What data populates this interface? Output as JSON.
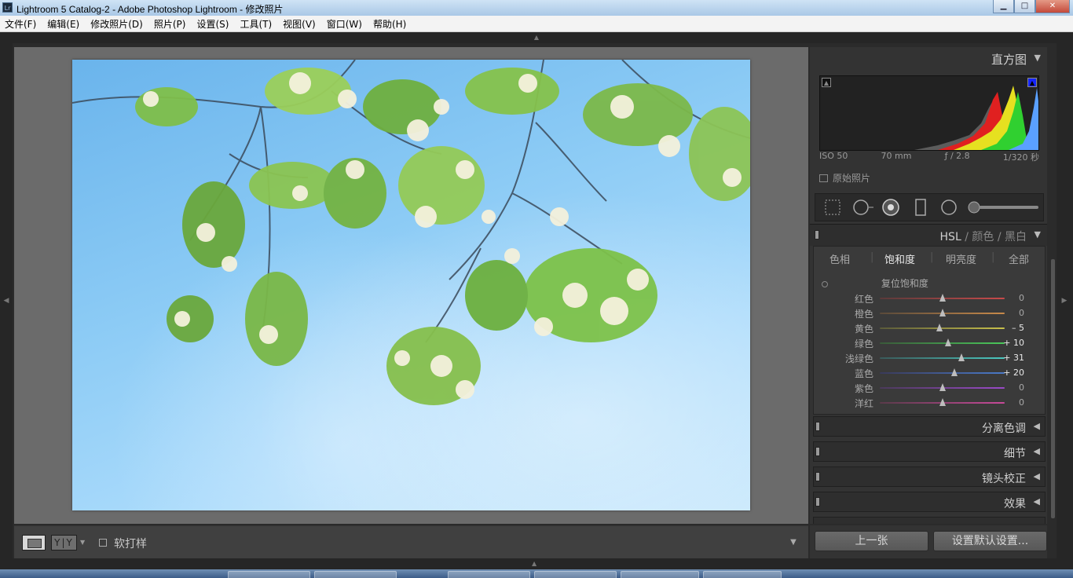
{
  "window": {
    "title": "Lightroom 5 Catalog-2 - Adobe Photoshop Lightroom - 修改照片",
    "app_icon": "Lr",
    "minimize": "▁",
    "maximize": "□",
    "close": "✕"
  },
  "menu": [
    "文件(F)",
    "编辑(E)",
    "修改照片(D)",
    "照片(P)",
    "设置(S)",
    "工具(T)",
    "视图(V)",
    "窗口(W)",
    "帮助(H)"
  ],
  "toolbar": {
    "soft_proof_label": "软打样",
    "soft_proof_checked": false,
    "yy_label": "Y|Y"
  },
  "histogram": {
    "title": "直方图",
    "iso": "ISO 50",
    "focal": "70 mm",
    "aperture": "ƒ / 2.8",
    "shutter": "1/320 秒",
    "original_label": "原始照片"
  },
  "hsl": {
    "tabs": [
      "HSL",
      "颜色",
      "黑白"
    ],
    "active_tab": "HSL",
    "subtabs": [
      "色相",
      "饱和度",
      "明亮度",
      "全部"
    ],
    "active_subtab": "饱和度",
    "reset_label": "复位饱和度",
    "sliders": [
      {
        "label": "红色",
        "value": 0,
        "display": "0",
        "color_from": "#5a3a3a",
        "color_to": "#c84a4a"
      },
      {
        "label": "橙色",
        "value": 0,
        "display": "0",
        "color_from": "#5a4a3a",
        "color_to": "#c88a4a"
      },
      {
        "label": "黄色",
        "value": -5,
        "display": "– 5",
        "color_from": "#5a5a3a",
        "color_to": "#c8c04a"
      },
      {
        "label": "绿色",
        "value": 10,
        "display": "+ 10",
        "color_from": "#3a5a3a",
        "color_to": "#4ac85a"
      },
      {
        "label": "浅绿色",
        "value": 31,
        "display": "+ 31",
        "color_from": "#3a5a5a",
        "color_to": "#4ac8c0"
      },
      {
        "label": "蓝色",
        "value": 20,
        "display": "+ 20",
        "color_from": "#3a3a5a",
        "color_to": "#4a7ac8"
      },
      {
        "label": "紫色",
        "value": 0,
        "display": "0",
        "color_from": "#4a3a5a",
        "color_to": "#9a4ac8"
      },
      {
        "label": "洋红",
        "value": 0,
        "display": "0",
        "color_from": "#5a3a4a",
        "color_to": "#c84a9a"
      }
    ]
  },
  "panels_collapsed": [
    "分离色调",
    "细节",
    "镜头校正",
    "效果"
  ],
  "buttons": {
    "previous": "上一张",
    "defaults": "设置默认设置..."
  }
}
